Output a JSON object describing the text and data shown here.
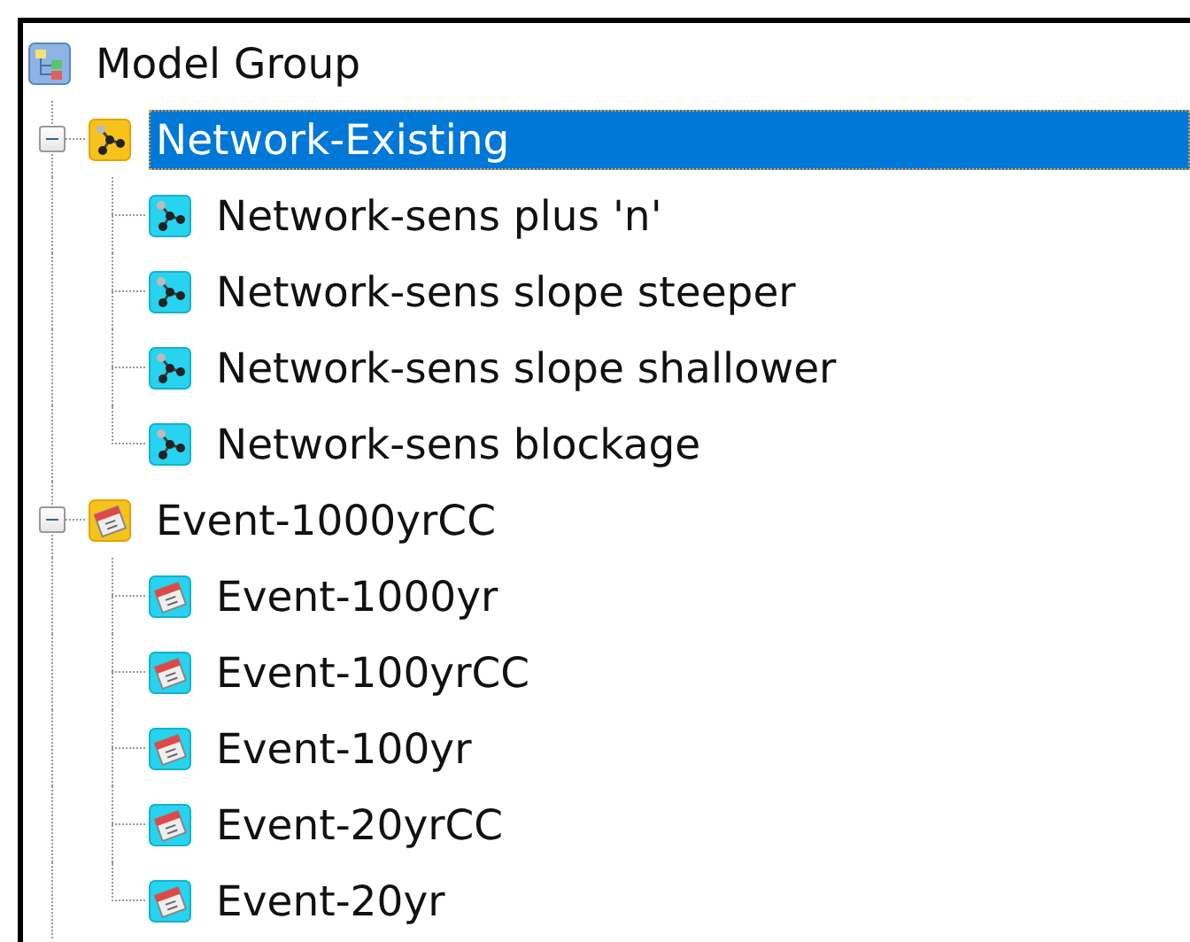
{
  "tree": {
    "label": "Model Group",
    "kind": "model",
    "selected": false,
    "children": [
      {
        "label": "Network-Existing",
        "kind": "network",
        "selected": true,
        "expanded": true,
        "children": [
          {
            "label": "Network-sens plus 'n'",
            "kind": "network",
            "selected": false
          },
          {
            "label": "Network-sens slope steeper",
            "kind": "network",
            "selected": false
          },
          {
            "label": "Network-sens slope shallower",
            "kind": "network",
            "selected": false
          },
          {
            "label": "Network-sens blockage",
            "kind": "network",
            "selected": false
          }
        ]
      },
      {
        "label": "Event-1000yrCC",
        "kind": "event",
        "selected": false,
        "expanded": true,
        "children": [
          {
            "label": "Event-1000yr",
            "kind": "event",
            "selected": false
          },
          {
            "label": "Event-100yrCC",
            "kind": "event",
            "selected": false
          },
          {
            "label": "Event-100yr",
            "kind": "event",
            "selected": false
          },
          {
            "label": "Event-20yrCC",
            "kind": "event",
            "selected": false
          },
          {
            "label": "Event-20yr",
            "kind": "event",
            "selected": false
          }
        ]
      }
    ]
  }
}
